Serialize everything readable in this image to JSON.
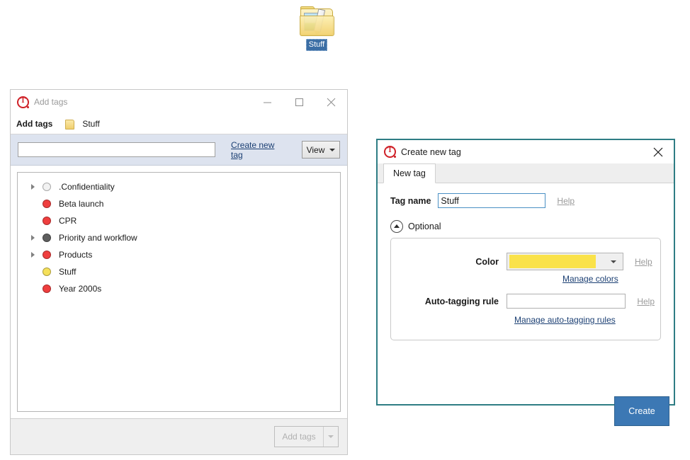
{
  "desktop": {
    "icon": {
      "label": "Stuff",
      "icon_name": "folder-with-image-icon",
      "selected": true
    }
  },
  "add_tags_window": {
    "title": "Add tags",
    "app_icon": "tagspaces-logo-icon",
    "window_controls": {
      "minimize": "minimize-icon",
      "maximize": "maximize-icon",
      "close": "close-icon"
    },
    "breadcrumb": {
      "label": "Add tags",
      "folder_icon": "folder-icon",
      "item": "Stuff"
    },
    "toolbar": {
      "search_value": "",
      "search_placeholder": "",
      "create_new_tag_link": "Create new tag",
      "view_button": "View"
    },
    "tag_list": [
      {
        "label": ".Confidentiality",
        "color": "#f2f2f2",
        "expandable": true
      },
      {
        "label": "Beta launch",
        "color": "#ef3e3e",
        "expandable": false
      },
      {
        "label": "CPR",
        "color": "#ef3e3e",
        "expandable": false
      },
      {
        "label": "Priority and workflow",
        "color": "#5e5e5e",
        "expandable": true
      },
      {
        "label": "Products",
        "color": "#ef3e3e",
        "expandable": true
      },
      {
        "label": "Stuff",
        "color": "#f5e05a",
        "expandable": false
      },
      {
        "label": "Year 2000s",
        "color": "#ef3e3e",
        "expandable": false
      }
    ],
    "footer": {
      "add_tags_button": "Add tags",
      "add_tags_button_enabled": false,
      "dropdown_icon": "caret-down-icon"
    }
  },
  "create_tag_dialog": {
    "title": "Create new tag",
    "app_icon": "tagspaces-logo-icon",
    "close_icon": "close-icon",
    "border_color": "#2e7d84",
    "tabs": [
      {
        "label": "New tag",
        "active": true
      }
    ],
    "tag_name": {
      "label": "Tag name",
      "value": "Stuff",
      "help_link": "Help"
    },
    "optional": {
      "label": "Optional",
      "expanded": true,
      "chevron_icon": "chevron-up-circle-icon",
      "color": {
        "label": "Color",
        "value": "#fae24a",
        "caret_icon": "chevron-down-icon",
        "help_link": "Help",
        "manage_link": "Manage colors"
      },
      "auto_tagging_rule": {
        "label": "Auto-tagging rule",
        "value": "",
        "help_link": "Help",
        "manage_link": "Manage auto-tagging rules"
      }
    },
    "create_button": {
      "label": "Create",
      "color": "#3c78b4"
    }
  }
}
